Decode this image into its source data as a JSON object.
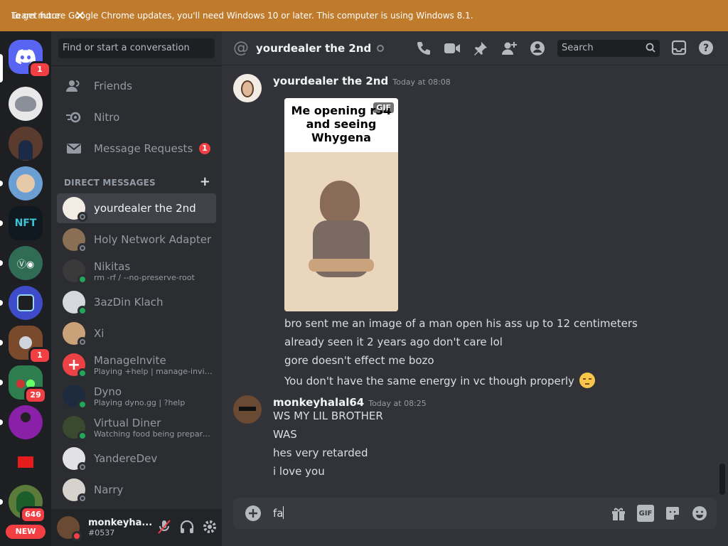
{
  "banner": {
    "message": "To get future Google Chrome updates, you'll need Windows 10 or later. This computer is using Windows 8.1.",
    "learn_more": "Learn more",
    "close": "✕"
  },
  "rail": {
    "home_badge": "1",
    "server_badges": {
      "s8": "1",
      "s9": "29",
      "s12": "646"
    },
    "new_label": "NEW"
  },
  "sidebar": {
    "search_placeholder": "Find or start a conversation",
    "nav": [
      {
        "label": "Friends"
      },
      {
        "label": "Nitro"
      },
      {
        "label": "Message Requests",
        "count": "1"
      }
    ],
    "dm_header": "DIRECT MESSAGES",
    "dms": [
      {
        "name": "yourdealer the 2nd",
        "sub": ""
      },
      {
        "name": "Holy Network Adapter",
        "sub": ""
      },
      {
        "name": "Nikitas",
        "sub": "rm -rf / --no-preserve-root"
      },
      {
        "name": "3azDin Klach",
        "sub": ""
      },
      {
        "name": "Xi",
        "sub": ""
      },
      {
        "name": "ManageInvite",
        "sub": "Playing +help | manage-invite...."
      },
      {
        "name": "Dyno",
        "sub": "Playing dyno.gg | ?help"
      },
      {
        "name": "Virtual Diner",
        "sub": "Watching food being prepared!"
      },
      {
        "name": "YandereDev",
        "sub": ""
      },
      {
        "name": "Narry",
        "sub": ""
      }
    ],
    "user": {
      "name": "monkeyha...",
      "tag": "#0537"
    }
  },
  "header": {
    "title": "yourdealer the 2nd",
    "search_placeholder": "Search"
  },
  "messages": [
    {
      "author": "yourdealer the 2nd",
      "time": "Today at 08:08",
      "gif_caption": "Me opening r34 and seeing Whygena",
      "gif_tag": "GIF",
      "lines": [
        "bro sent me an image of a man open his ass up to 12 centimeters",
        "already seen it 2 years ago don't care lol",
        "gore doesn't effect me bozo",
        "You don't have the same energy in vc though properly"
      ]
    },
    {
      "author": "monkeyhalal64",
      "time": "Today at 08:25",
      "lines": [
        "WS MY LIL BROTHER",
        "WAS",
        "hes very retarded",
        "i love you"
      ]
    }
  ],
  "composer": {
    "value": "fa",
    "gif_label": "GIF"
  }
}
